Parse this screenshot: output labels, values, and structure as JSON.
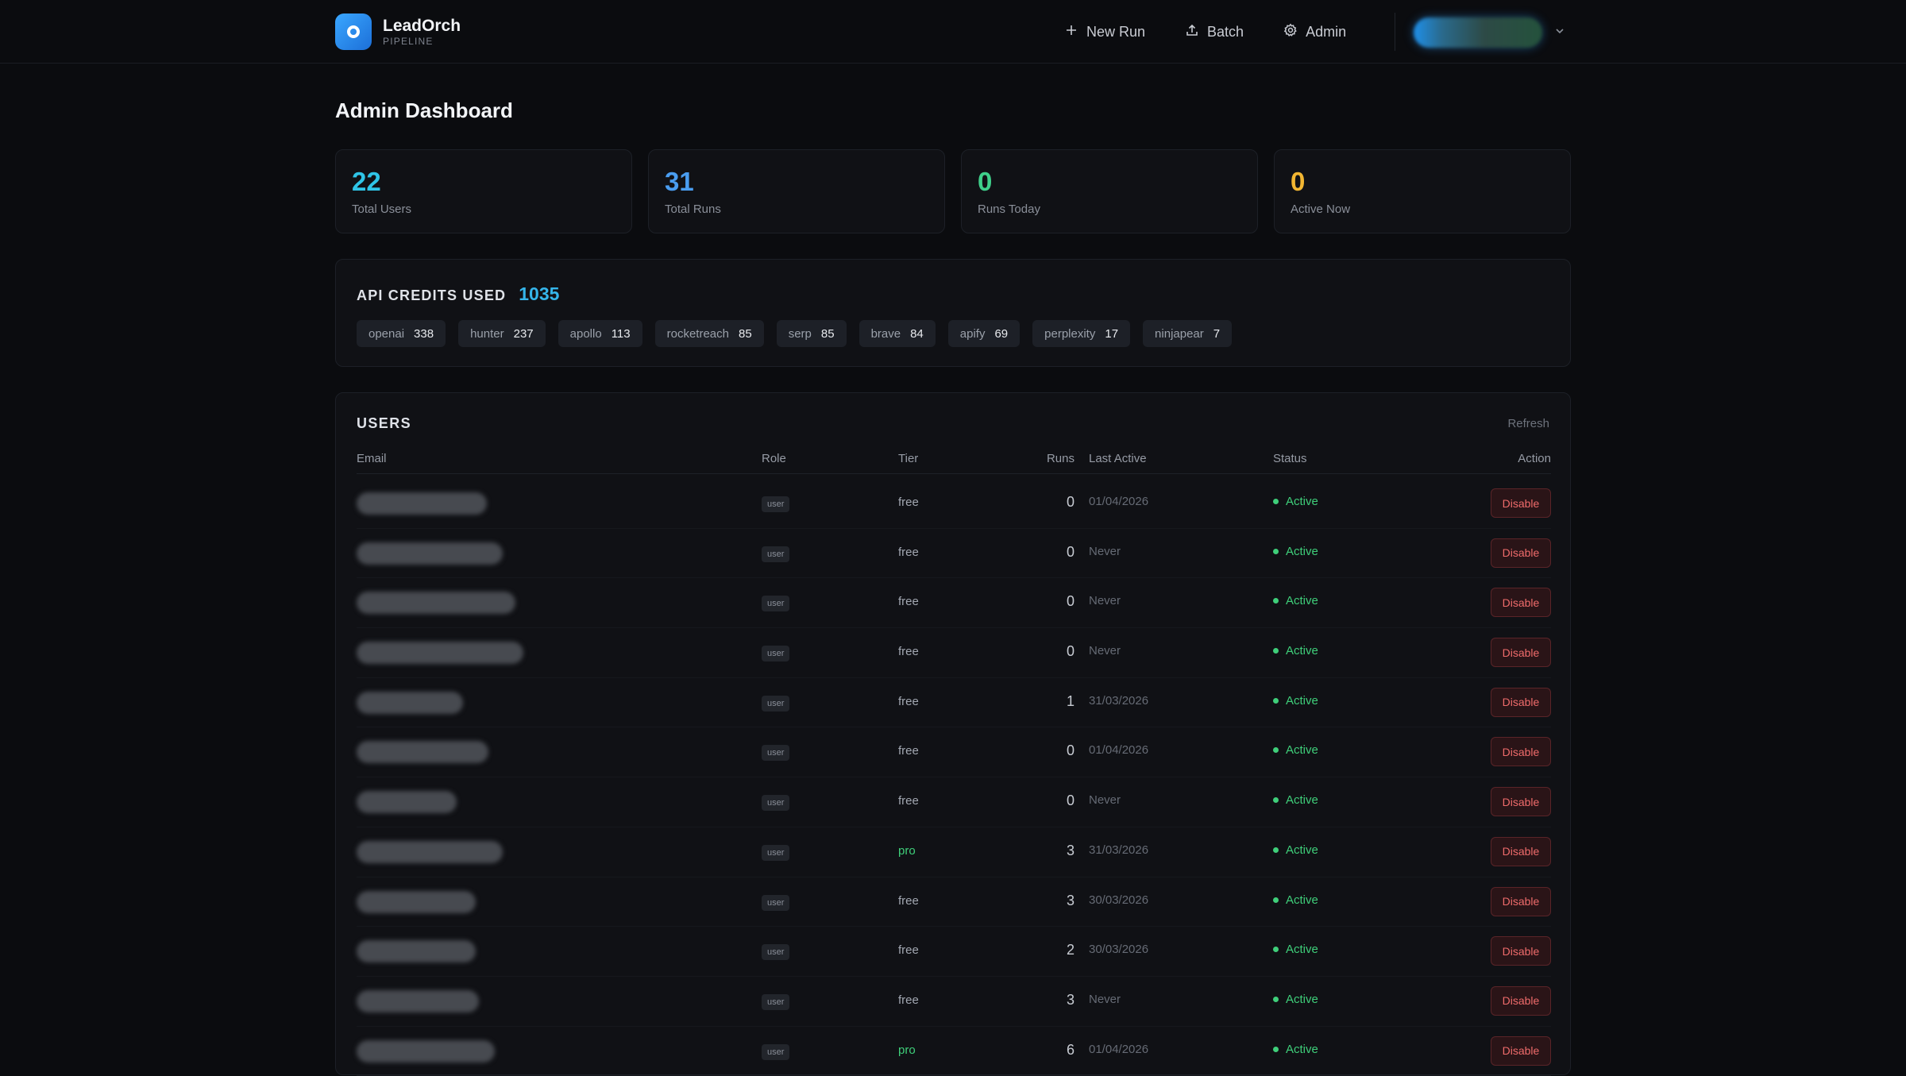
{
  "brand": {
    "name": "LeadOrch",
    "sub": "PIPELINE"
  },
  "nav": [
    {
      "label": "New Run",
      "icon": "plus-icon"
    },
    {
      "label": "Batch",
      "icon": "upload-icon"
    },
    {
      "label": "Admin",
      "icon": "gear-icon"
    }
  ],
  "page": {
    "title": "Admin Dashboard"
  },
  "stats": [
    {
      "value": "22",
      "label": "Total Users",
      "color": "#2fc4e6"
    },
    {
      "value": "31",
      "label": "Total Runs",
      "color": "#4a9df0"
    },
    {
      "value": "0",
      "label": "Runs Today",
      "color": "#3fcf8a"
    },
    {
      "value": "0",
      "label": "Active Now",
      "color": "#f2b632"
    }
  ],
  "credits": {
    "title": "API CREDITS USED",
    "total": "1035",
    "items": [
      {
        "name": "openai",
        "value": "338"
      },
      {
        "name": "hunter",
        "value": "237"
      },
      {
        "name": "apollo",
        "value": "113"
      },
      {
        "name": "rocketreach",
        "value": "85"
      },
      {
        "name": "serp",
        "value": "85"
      },
      {
        "name": "brave",
        "value": "84"
      },
      {
        "name": "apify",
        "value": "69"
      },
      {
        "name": "perplexity",
        "value": "17"
      },
      {
        "name": "ninjapear",
        "value": "7"
      }
    ]
  },
  "users": {
    "title": "USERS",
    "refresh": "Refresh",
    "columns": {
      "email": "Email",
      "role": "Role",
      "tier": "Tier",
      "runs": "Runs",
      "last_active": "Last Active",
      "status": "Status",
      "action": "Action"
    },
    "rows": [
      {
        "role": "user",
        "tier": "free",
        "runs": "0",
        "last_active": "01/04/2026",
        "status": "Active",
        "action": "Disable"
      },
      {
        "role": "user",
        "tier": "free",
        "runs": "0",
        "last_active": "Never",
        "status": "Active",
        "action": "Disable"
      },
      {
        "role": "user",
        "tier": "free",
        "runs": "0",
        "last_active": "Never",
        "status": "Active",
        "action": "Disable"
      },
      {
        "role": "user",
        "tier": "free",
        "runs": "0",
        "last_active": "Never",
        "status": "Active",
        "action": "Disable"
      },
      {
        "role": "user",
        "tier": "free",
        "runs": "1",
        "last_active": "31/03/2026",
        "status": "Active",
        "action": "Disable"
      },
      {
        "role": "user",
        "tier": "free",
        "runs": "0",
        "last_active": "01/04/2026",
        "status": "Active",
        "action": "Disable"
      },
      {
        "role": "user",
        "tier": "free",
        "runs": "0",
        "last_active": "Never",
        "status": "Active",
        "action": "Disable"
      },
      {
        "role": "user",
        "tier": "pro",
        "runs": "3",
        "last_active": "31/03/2026",
        "status": "Active",
        "action": "Disable"
      },
      {
        "role": "user",
        "tier": "free",
        "runs": "3",
        "last_active": "30/03/2026",
        "status": "Active",
        "action": "Disable"
      },
      {
        "role": "user",
        "tier": "free",
        "runs": "2",
        "last_active": "30/03/2026",
        "status": "Active",
        "action": "Disable"
      },
      {
        "role": "user",
        "tier": "free",
        "runs": "3",
        "last_active": "Never",
        "status": "Active",
        "action": "Disable"
      },
      {
        "role": "user",
        "tier": "pro",
        "runs": "6",
        "last_active": "01/04/2026",
        "status": "Active",
        "action": "Disable"
      }
    ]
  }
}
